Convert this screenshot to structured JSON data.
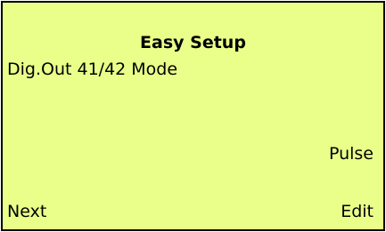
{
  "display": {
    "title": "Easy Setup",
    "parameter_name": "Dig.Out 41/42 Mode",
    "parameter_value": "Pulse",
    "background_color": "#eaff8a",
    "border_color": "#000000"
  },
  "softkeys": {
    "left_label": "Next",
    "right_label": "Edit"
  }
}
